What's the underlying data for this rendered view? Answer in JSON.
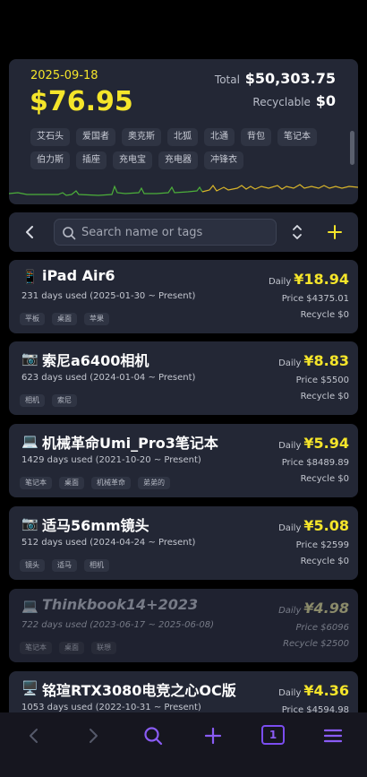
{
  "summary": {
    "date": "2025-09-18",
    "daily_amount": "$76.95",
    "total_label": "Total",
    "total_value": "$50,303.75",
    "recyclable_label": "Recyclable",
    "recyclable_value": "$0",
    "tags": [
      "艾石头",
      "爱国者",
      "奥克斯",
      "北狐",
      "北通",
      "背包",
      "笔记本",
      "伯力斯",
      "插座",
      "充电宝",
      "充电器",
      "冲锋衣"
    ]
  },
  "toolbar": {
    "search_placeholder": "Search name or tags"
  },
  "items": [
    {
      "icon": "📱",
      "name": "iPad Air6",
      "days": "231 days used (2025-01-30 ~ Present)",
      "tags": [
        "平板",
        "桌面",
        "苹果"
      ],
      "daily_label": "Daily",
      "daily": "¥18.94",
      "price": "Price $4375.01",
      "recycle": "Recycle $0",
      "retired": false
    },
    {
      "icon": "📷",
      "name": "索尼a6400相机",
      "days": "623 days used (2024-01-04 ~ Present)",
      "tags": [
        "相机",
        "索尼"
      ],
      "daily_label": "Daily",
      "daily": "¥8.83",
      "price": "Price $5500",
      "recycle": "Recycle $0",
      "retired": false
    },
    {
      "icon": "💻",
      "name": "机械革命Umi_Pro3笔记本",
      "days": "1429 days used (2021-10-20 ~ Present)",
      "tags": [
        "笔记本",
        "桌面",
        "机械革命",
        "弟弟的"
      ],
      "daily_label": "Daily",
      "daily": "¥5.94",
      "price": "Price $8489.89",
      "recycle": "Recycle $0",
      "retired": false
    },
    {
      "icon": "📷",
      "name": "适马56mm镜头",
      "days": "512 days used (2024-04-24 ~ Present)",
      "tags": [
        "镜头",
        "适马",
        "相机"
      ],
      "daily_label": "Daily",
      "daily": "¥5.08",
      "price": "Price $2599",
      "recycle": "Recycle $0",
      "retired": false
    },
    {
      "icon": "💻",
      "name": "Thinkbook14+2023",
      "days": "722 days used (2023-06-17 ~ 2025-06-08)",
      "tags": [
        "笔记本",
        "桌面",
        "联想"
      ],
      "daily_label": "Daily",
      "daily": "¥4.98",
      "price": "Price $6096",
      "recycle": "Recycle $2500",
      "retired": true
    },
    {
      "icon": "🖥️",
      "name": "铭瑄RTX3080电竞之心OC版",
      "days": "1053 days used (2022-10-31 ~ Present)",
      "tags": [],
      "daily_label": "Daily",
      "daily": "¥4.36",
      "price": "Price $4594.98",
      "recycle": "",
      "retired": false
    }
  ],
  "bottom_nav": {
    "page_count": "1"
  },
  "colors": {
    "accent_yellow": "#f5e52a",
    "accent_purple": "#7b4df0",
    "card_bg": "#232735",
    "spark_green": "#4caf3a",
    "spark_yellow": "#d9b52a"
  }
}
